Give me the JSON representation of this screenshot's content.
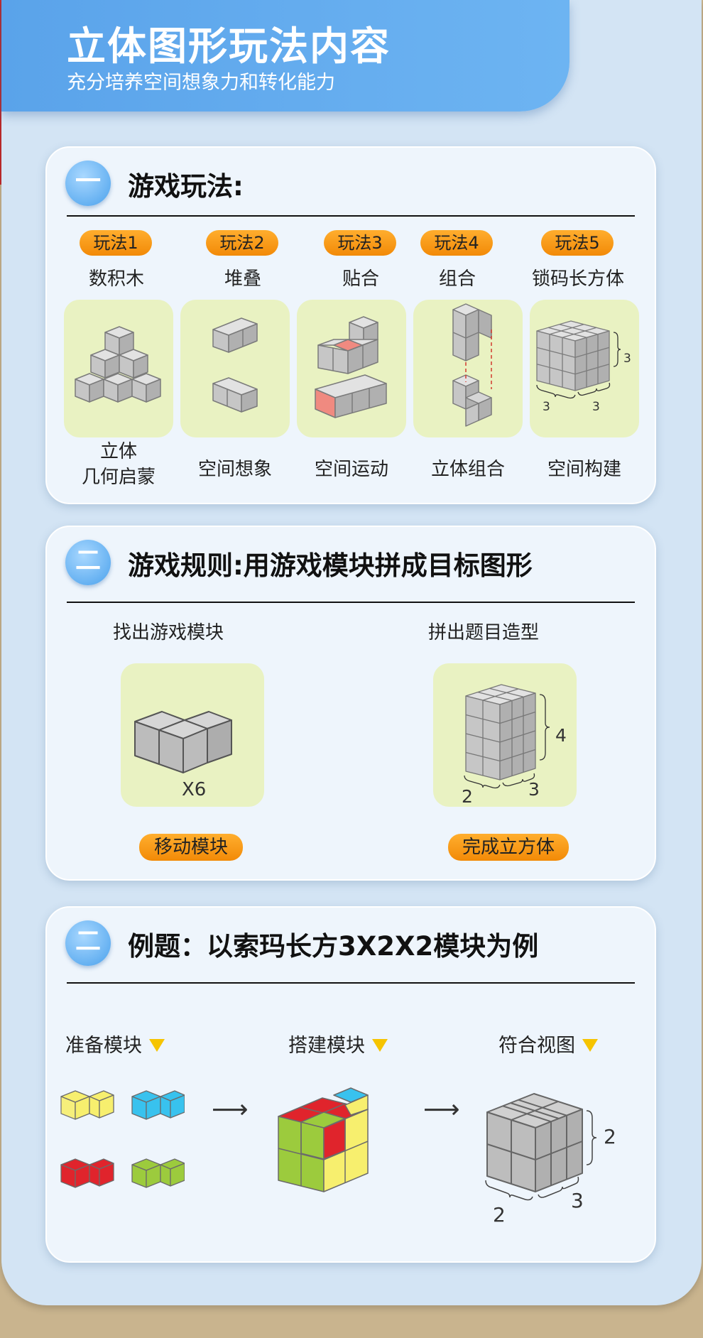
{
  "header": {
    "title": "立体图形玩法内容",
    "subtitle": "充分培养空间想象力和转化能力"
  },
  "section1": {
    "badge": "一",
    "title": "游戏玩法:",
    "items": [
      {
        "tag": "玩法1",
        "name": "数积木",
        "caption": "立体\n几何启蒙"
      },
      {
        "tag": "玩法2",
        "name": "堆叠",
        "caption": "空间想象"
      },
      {
        "tag": "玩法3",
        "name": "贴合",
        "caption": "空间运动"
      },
      {
        "tag": "玩法4",
        "name": "组合",
        "caption": "立体组合"
      },
      {
        "tag": "玩法5",
        "name": "锁码长方体",
        "caption": "空间构建"
      }
    ],
    "dims": {
      "height": "3",
      "depth": "3",
      "width": "3"
    }
  },
  "section2": {
    "badge": "二",
    "title": "游戏规则:用游戏模块拼成目标图形",
    "left_heading": "找出游戏模块",
    "left_count": "X6",
    "left_button": "移动模块",
    "right_heading": "拼出题目造型",
    "right_dims": {
      "height": "4",
      "depth": "2",
      "width": "3"
    },
    "right_button": "完成立方体"
  },
  "section3": {
    "badge": "二",
    "title": "例题：以索玛长方3X2X2模块为例",
    "steps": [
      "准备模块",
      "搭建模块",
      "符合视图"
    ],
    "dims": {
      "height": "2",
      "depth": "2",
      "width": "3"
    }
  },
  "colors": {
    "accent_blue": "#5aa3ea",
    "pill_orange": "#f28a07",
    "tile_green": "#e9f2c2",
    "cube_gray": "#b9b9b9",
    "yellow": "#f7ef6e",
    "cyan": "#38c2ee",
    "red": "#e0242c",
    "green": "#9ccb3d"
  }
}
